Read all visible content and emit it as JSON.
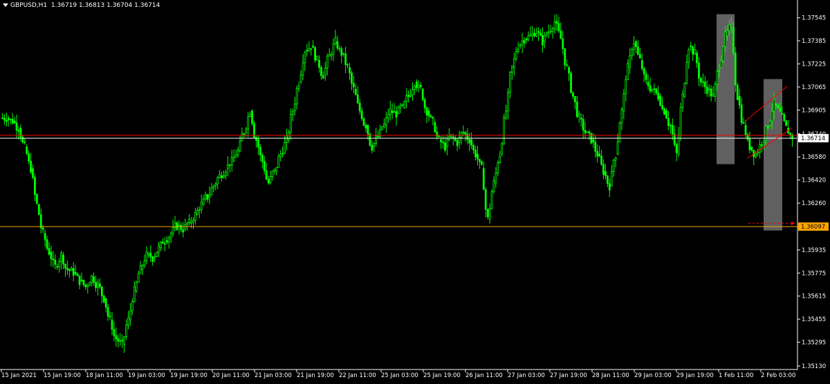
{
  "header": {
    "symbol": "GBPUSD,H1",
    "ohlc": "1.36719 1.36813 1.36704 1.36714"
  },
  "colors": {
    "background": "#000000",
    "candle": "#00ff00",
    "axis_text": "#ffffff",
    "red_level": "#ff0000",
    "orange_level": "#ffa500",
    "gray_rect": "#808080",
    "price_label_bg": "#ffffff",
    "orange_label_bg": "#ffa500"
  },
  "chart_data": {
    "type": "candlestick",
    "y_axis": {
      "min": 1.3513,
      "max": 1.3763,
      "ticks": [
        "1.37545",
        "1.37385",
        "1.37225",
        "1.37065",
        "1.36905",
        "1.36740",
        "1.36580",
        "1.36420",
        "1.36260",
        "1.36097",
        "1.35935",
        "1.35775",
        "1.35615",
        "1.35455",
        "1.35295",
        "1.35130"
      ]
    },
    "x_axis": {
      "labels": [
        "15 Jan 2021",
        "15 Jan 19:00",
        "18 Jan 11:00",
        "19 Jan 03:00",
        "19 Jan 19:00",
        "20 Jan 11:00",
        "21 Jan 03:00",
        "21 Jan 19:00",
        "22 Jan 11:00",
        "25 Jan 03:00",
        "25 Jan 19:00",
        "26 Jan 11:00",
        "27 Jan 03:00",
        "27 Jan 19:00",
        "28 Jan 11:00",
        "29 Jan 03:00",
        "29 Jan 19:00",
        "1 Feb 11:00",
        "2 Feb 03:00"
      ]
    },
    "current_price_label": "1.36714",
    "orange_level_label": "1.36097",
    "levels": [
      {
        "name": "red-level",
        "price": 1.3673
      },
      {
        "name": "white-level",
        "price": 1.3671
      },
      {
        "name": "orange-level",
        "price": 1.36097
      }
    ],
    "close_path": [
      1.3685,
      1.3683,
      1.3678,
      1.3665,
      1.365,
      1.3625,
      1.3605,
      1.3592,
      1.3582,
      1.359,
      1.358,
      1.3578,
      1.3572,
      1.3568,
      1.3575,
      1.357,
      1.356,
      1.3545,
      1.3532,
      1.3528,
      1.3545,
      1.3565,
      1.358,
      1.359,
      1.3588,
      1.3595,
      1.36,
      1.3605,
      1.361,
      1.3608,
      1.3612,
      1.3618,
      1.3625,
      1.363,
      1.3638,
      1.3645,
      1.365,
      1.3655,
      1.3662,
      1.3675,
      1.369,
      1.367,
      1.3655,
      1.364,
      1.3648,
      1.366,
      1.367,
      1.369,
      1.371,
      1.3732,
      1.3735,
      1.3725,
      1.3715,
      1.3728,
      1.3738,
      1.373,
      1.372,
      1.3705,
      1.369,
      1.368,
      1.3665,
      1.3672,
      1.368,
      1.369,
      1.3688,
      1.3692,
      1.37,
      1.371,
      1.3705,
      1.369,
      1.3682,
      1.367,
      1.3665,
      1.3672,
      1.3668,
      1.3675,
      1.367,
      1.366,
      1.365,
      1.3615,
      1.364,
      1.366,
      1.369,
      1.372,
      1.3735,
      1.374,
      1.3742,
      1.3745,
      1.3738,
      1.3745,
      1.3752,
      1.374,
      1.372,
      1.37,
      1.3685,
      1.3675,
      1.367,
      1.366,
      1.3648,
      1.3638,
      1.366,
      1.369,
      1.372,
      1.3738,
      1.3725,
      1.371,
      1.3705,
      1.37,
      1.369,
      1.368,
      1.366,
      1.37,
      1.3735,
      1.373,
      1.371,
      1.3705,
      1.37,
      1.372,
      1.3742,
      1.3748,
      1.37,
      1.368,
      1.3665,
      1.366,
      1.3668,
      1.368,
      1.3695,
      1.3688,
      1.3678,
      1.3672
    ],
    "overlays": {
      "gray_rects": [
        {
          "name": "gray-zone-1",
          "price_top": 1.3757,
          "price_bottom": 1.3653
        },
        {
          "name": "gray-zone-2",
          "price_top": 1.3712,
          "price_bottom": 1.3607
        }
      ],
      "channel": {
        "upper": [
          1.3683,
          1.3707
        ],
        "lower": [
          1.3657,
          1.3678
        ]
      },
      "dashed_arrow_price": 1.3612
    }
  }
}
